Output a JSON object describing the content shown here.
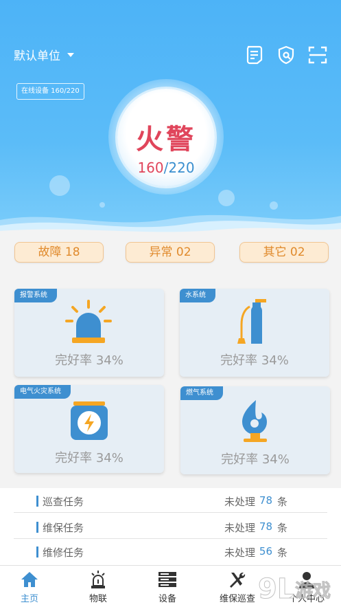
{
  "header": {
    "unit_label": "默认单位",
    "icons": [
      "report-icon",
      "shield-icon",
      "scan-icon"
    ]
  },
  "hero": {
    "online_devices": "在线设备 160/220",
    "alarm_label": "火警",
    "alarm_count": "160",
    "alarm_total": "/220"
  },
  "tags": [
    {
      "label": "故障  18"
    },
    {
      "label": "异常  02"
    },
    {
      "label": "其它  02"
    }
  ],
  "cards": [
    {
      "label": "报警系统",
      "rate": "完好率   34%",
      "icon": "siren-icon"
    },
    {
      "label": "水系统",
      "rate": "完好率   34%",
      "icon": "extinguisher-icon"
    },
    {
      "label": "电气火灾系统",
      "rate": "完好率   34%",
      "icon": "lightning-icon"
    },
    {
      "label": "燃气系统",
      "rate": "完好率   34%",
      "icon": "gas-flame-icon"
    }
  ],
  "tasks": [
    {
      "name": "巡查任务",
      "status": "未处理",
      "count": "78",
      "unit": "条"
    },
    {
      "name": "维保任务",
      "status": "未处理",
      "count": "78",
      "unit": "条"
    },
    {
      "name": "维修任务",
      "status": "未处理",
      "count": "56",
      "unit": "条"
    }
  ],
  "nav": [
    {
      "label": "主页",
      "icon": "home-icon",
      "active": true
    },
    {
      "label": "物联",
      "icon": "iot-siren-icon",
      "active": false
    },
    {
      "label": "设备",
      "icon": "device-icon",
      "active": false
    },
    {
      "label": "维保巡查",
      "icon": "tools-icon",
      "active": false
    },
    {
      "label": "个人中心",
      "icon": "user-icon",
      "active": false
    }
  ],
  "colors": {
    "primary": "#3e8fd0",
    "alarm": "#e0455b",
    "tag_bg": "#fdebd3",
    "tag_text": "#e08a2c",
    "card_bg": "#e6eef5",
    "icon_orange": "#f5a623"
  }
}
